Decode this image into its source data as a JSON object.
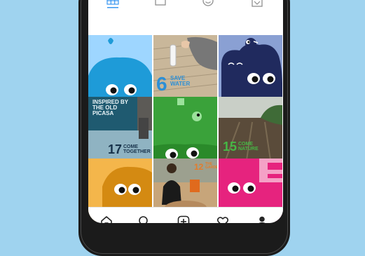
{
  "tab_icons": [
    "grid-icon",
    "igtv-icon",
    "smiley-icon",
    "tagged-icon"
  ],
  "tiles": [
    {
      "name": "tile-blue-monster",
      "bg": "#9ed6ff"
    },
    {
      "name": "tile-6-save-water",
      "bg": "#c9b79a",
      "big": "6",
      "small": "SAVE\nWATER",
      "text_color": "#2c8fd6"
    },
    {
      "name": "tile-navy-monster",
      "bg": "#8aa0d3"
    },
    {
      "name": "tile-17-come-together",
      "bg": "#2e6d86",
      "poster_top": "INSPIRED BY\nTHE OLD\nPICASA",
      "big": "17",
      "small": "COME\nTOGETHER",
      "text_color": "#17324a"
    },
    {
      "name": "tile-green-monster",
      "bg": "#3aa23a"
    },
    {
      "name": "tile-15-come-nature",
      "bg": "#6b6b55",
      "big": "15",
      "small": "COME\nNATURE",
      "text_color": "#45b845"
    },
    {
      "name": "tile-orange-monster",
      "bg": "#f4b64b"
    },
    {
      "name": "tile-12-the-garden",
      "bg": "#c7a57a",
      "big": "12",
      "small": "THE\nGARDEN",
      "text_color": "#e47c2a"
    },
    {
      "name": "tile-pink-monster",
      "bg": "#e6237e"
    }
  ],
  "nav": [
    "home-icon",
    "search-icon",
    "new-post-icon",
    "activity-heart-icon",
    "profile-icon"
  ],
  "colors": {
    "background": "#9fd3ef",
    "phone": "#1b1b1b",
    "screen": "#ffffff",
    "icon": "#262626"
  }
}
